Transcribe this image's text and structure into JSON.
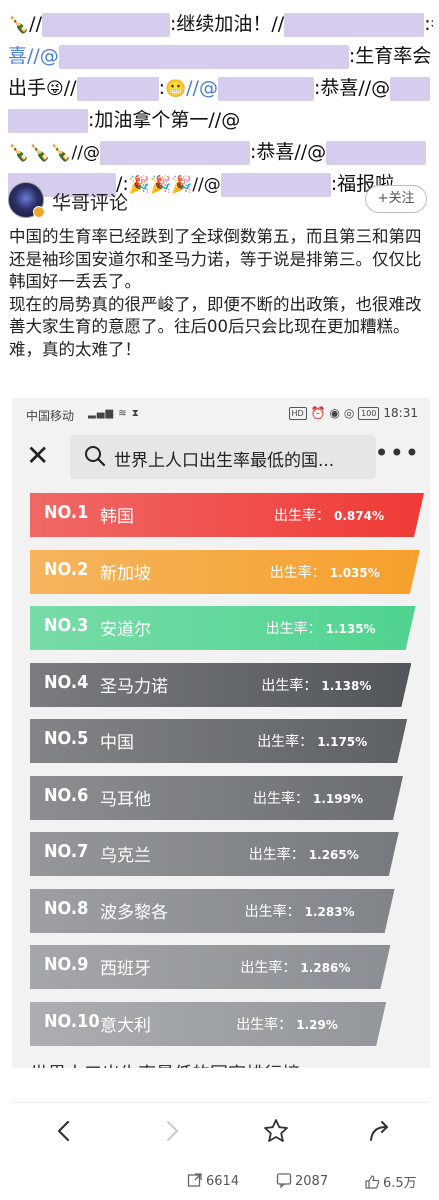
{
  "comments": {
    "line1_text": ":继续加油！//",
    "line1_tail": ":恭",
    "line2_head": "喜//@",
    "line2_tail": ":生育率会",
    "line3_head": "出手",
    "line3_text_a": ":",
    "line3_text_b": "//@",
    "line3_text_c": ":恭喜//@",
    "line4_text": ":加油拿个第一//@",
    "line5_head_emoji": "🍾🍾🍾//@",
    "line5_text": ":恭喜//@",
    "line6_text": "/:",
    "line6_emoji": "🎉🎉🎉//@",
    "line6_tail": ":福报啦"
  },
  "author": {
    "name": "华哥评论",
    "follow_label": "+关注"
  },
  "post": {
    "paragraphs": [
      "中国的生育率已经跌到了全球倒数第五，而且第三和第四还是袖珍国安道尔和圣马力诺，等于说是排第三。仅仅比韩国好一丢丢了。",
      "现在的局势真的很严峻了，即便不断的出政策，也很难改善大家生育的意愿了。往后00后只会比现在更加糟糕。",
      "难，真的太难了！"
    ]
  },
  "screenshot": {
    "status_bar": {
      "carrier": "中国移动",
      "signal": "⁴ᴳ",
      "right_icons": "HD",
      "battery": "100",
      "time": "18:31"
    },
    "search_text": "世界上人口出生率最低的国...",
    "rate_label": "出生率：",
    "rankings": [
      {
        "no": "NO.1",
        "name": "韩国",
        "rate": "0.874%",
        "color": "#f03a36"
      },
      {
        "no": "NO.2",
        "name": "新加坡",
        "rate": "1.035%",
        "color": "#f6a02c"
      },
      {
        "no": "NO.3",
        "name": "安道尔",
        "rate": "1.135%",
        "color": "#4fd48f"
      },
      {
        "no": "NO.4",
        "name": "圣马力诺",
        "rate": "1.138%",
        "color": "#525559"
      },
      {
        "no": "NO.5",
        "name": "中国",
        "rate": "1.175%",
        "color": "#5d6064"
      },
      {
        "no": "NO.6",
        "name": "马耳他",
        "rate": "1.199%",
        "color": "#6a6d71"
      },
      {
        "no": "NO.7",
        "name": "乌克兰",
        "rate": "1.265%",
        "color": "#76797d"
      },
      {
        "no": "NO.8",
        "name": "波多黎各",
        "rate": "1.283%",
        "color": "#818488"
      },
      {
        "no": "NO.9",
        "name": "西班牙",
        "rate": "1.286%",
        "color": "#8b8e92"
      },
      {
        "no": "NO.10",
        "name": "意大利",
        "rate": "1.29%",
        "color": "#94979b"
      }
    ],
    "next_title": "世界人口出生率最低的国家排行榜"
  },
  "stats": {
    "shares": "6614",
    "comments": "2087",
    "likes": "6.5万"
  }
}
